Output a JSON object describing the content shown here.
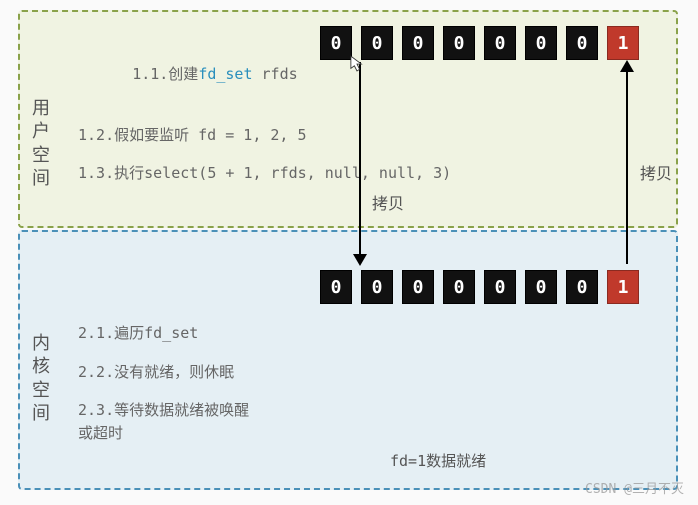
{
  "user_space": {
    "label": "用户空间",
    "steps": {
      "s1_prefix": "1.1.创建",
      "s1_type": "fd_set",
      "s1_suffix": " rfds",
      "s2": "1.2.假如要监听 fd = 1, 2, 5",
      "s3": "1.3.执行select(5 + 1, rfds, null, null, 3)"
    }
  },
  "kernel_space": {
    "label": "内核空间",
    "steps": {
      "s1": "2.1.遍历fd_set",
      "s2": "2.2.没有就绪，则休眠",
      "s3": "2.3.等待数据就绪被唤醒\n或超时"
    }
  },
  "bits_user": [
    "0",
    "0",
    "0",
    "0",
    "0",
    "0",
    "0",
    "1"
  ],
  "bits_kernel": [
    "0",
    "0",
    "0",
    "0",
    "0",
    "0",
    "0",
    "1"
  ],
  "copy_down_label": "拷贝",
  "copy_up_label": "拷贝",
  "ready_label": "fd=1数据就绪",
  "watermark": "CSDN @三月不灭"
}
